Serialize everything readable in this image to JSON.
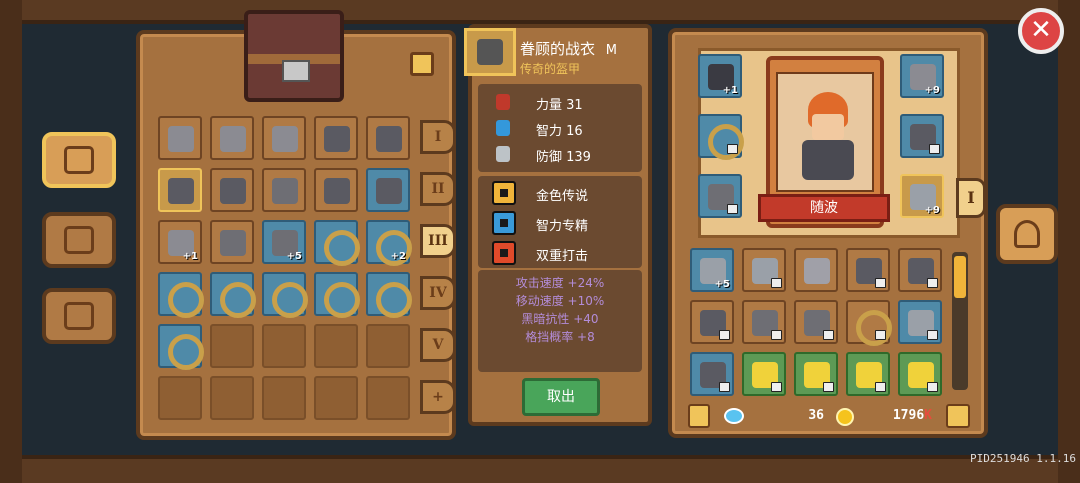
{
  "item_detail": {
    "name": "眷顾的战衣",
    "grade_mark": "M",
    "subtitle": "传奇的盔甲",
    "stats": [
      {
        "icon": "fist-icon",
        "label": "力量 31",
        "color": "#c0392b"
      },
      {
        "icon": "book-icon",
        "label": "智力 16",
        "color": "#3498db"
      },
      {
        "icon": "shield-icon",
        "label": "防御 139",
        "color": "#bdc3c7"
      }
    ],
    "skills": [
      {
        "icon": "flame-icon",
        "label": "金色传说"
      },
      {
        "icon": "scroll-icon",
        "label": "智力专精"
      },
      {
        "icon": "double-strike-icon",
        "label": "双重打击"
      }
    ],
    "bonuses": [
      "攻击速度 +24%",
      "移动速度 +10%",
      "黑暗抗性 +40",
      "格挡概率 +8"
    ],
    "take_out_label": "取出"
  },
  "storage": {
    "tabs": [
      "I",
      "II",
      "III",
      "IV",
      "V",
      "+"
    ],
    "active_tab": 2,
    "rows": [
      [
        {
          "t": "item",
          "icon": "helmet-icon"
        },
        {
          "t": "item",
          "icon": "helmet-icon"
        },
        {
          "t": "item",
          "icon": "helmet-icon"
        },
        {
          "t": "item",
          "icon": "armor-icon"
        },
        {
          "t": "item",
          "icon": "armor-icon"
        }
      ],
      [
        {
          "t": "gold",
          "icon": "armor-icon"
        },
        {
          "t": "item",
          "icon": "armor-icon"
        },
        {
          "t": "item",
          "icon": "boots-icon"
        },
        {
          "t": "item",
          "icon": "armor-icon"
        },
        {
          "t": "blue",
          "icon": "armor-icon"
        }
      ],
      [
        {
          "t": "item",
          "icon": "helmet-icon",
          "badge": "+1"
        },
        {
          "t": "item",
          "icon": "boots-icon"
        },
        {
          "t": "blue",
          "icon": "boots-icon",
          "badge": "+5"
        },
        {
          "t": "blue",
          "icon": "ring-icon"
        },
        {
          "t": "blue",
          "icon": "ring-icon",
          "badge": "+2"
        }
      ],
      [
        {
          "t": "blue",
          "icon": "ring-icon"
        },
        {
          "t": "blue",
          "icon": "ring-icon"
        },
        {
          "t": "blue",
          "icon": "ring-icon"
        },
        {
          "t": "blue",
          "icon": "ring-icon"
        },
        {
          "t": "blue",
          "icon": "ring-icon"
        }
      ],
      [
        {
          "t": "blue",
          "icon": "ring-icon"
        },
        {
          "t": "empty"
        },
        {
          "t": "empty"
        },
        {
          "t": "empty"
        },
        {
          "t": "empty"
        }
      ],
      [
        {
          "t": "empty"
        },
        {
          "t": "empty"
        },
        {
          "t": "empty"
        },
        {
          "t": "empty"
        },
        {
          "t": "empty"
        }
      ]
    ]
  },
  "hero": {
    "name": "随波",
    "equip_left": [
      {
        "icon": "weapon-icon",
        "badge": "+1"
      },
      {
        "icon": "ring-icon",
        "lock": true
      },
      {
        "icon": "boots-icon",
        "lock": true
      }
    ],
    "equip_right": [
      {
        "icon": "helmet-icon",
        "badge": "+9"
      },
      {
        "icon": "armor-icon",
        "lock": true
      },
      {
        "icon": "sword-icon",
        "badge": "+9"
      }
    ],
    "tab_label": "I"
  },
  "inventory": {
    "rows": [
      [
        {
          "t": "blue",
          "icon": "sword-icon",
          "badge": "+5"
        },
        {
          "t": "item",
          "icon": "sword-icon",
          "lock": true
        },
        {
          "t": "item",
          "icon": "crossed-swords-icon"
        },
        {
          "t": "item",
          "icon": "armor-icon",
          "lock": true
        },
        {
          "t": "item",
          "icon": "armor-icon",
          "lock": true
        }
      ],
      [
        {
          "t": "item",
          "icon": "armor-icon",
          "lock": true
        },
        {
          "t": "item",
          "icon": "boots-icon",
          "lock": true
        },
        {
          "t": "item",
          "icon": "boots-icon",
          "lock": true
        },
        {
          "t": "item",
          "icon": "ring-icon",
          "lock": true
        },
        {
          "t": "blue",
          "icon": "sword-icon",
          "lock": true
        }
      ],
      [
        {
          "t": "blue",
          "icon": "armor-icon",
          "lock": true
        },
        {
          "t": "green",
          "icon": "potion-icon",
          "lock": true
        },
        {
          "t": "green",
          "icon": "potion-icon",
          "lock": true
        },
        {
          "t": "green",
          "icon": "potion-icon",
          "lock": true
        },
        {
          "t": "green",
          "icon": "potion-icon",
          "lock": true
        }
      ]
    ],
    "gems": "36",
    "gold": "1796",
    "gold_suffix": "K"
  },
  "pid_version": "PID251946 1.1.16",
  "colors": {
    "panel": "#a5713f",
    "rare_blue": "#4f8aa8",
    "epic_purple": "#b38cd8",
    "accept_green": "#49a55a"
  }
}
